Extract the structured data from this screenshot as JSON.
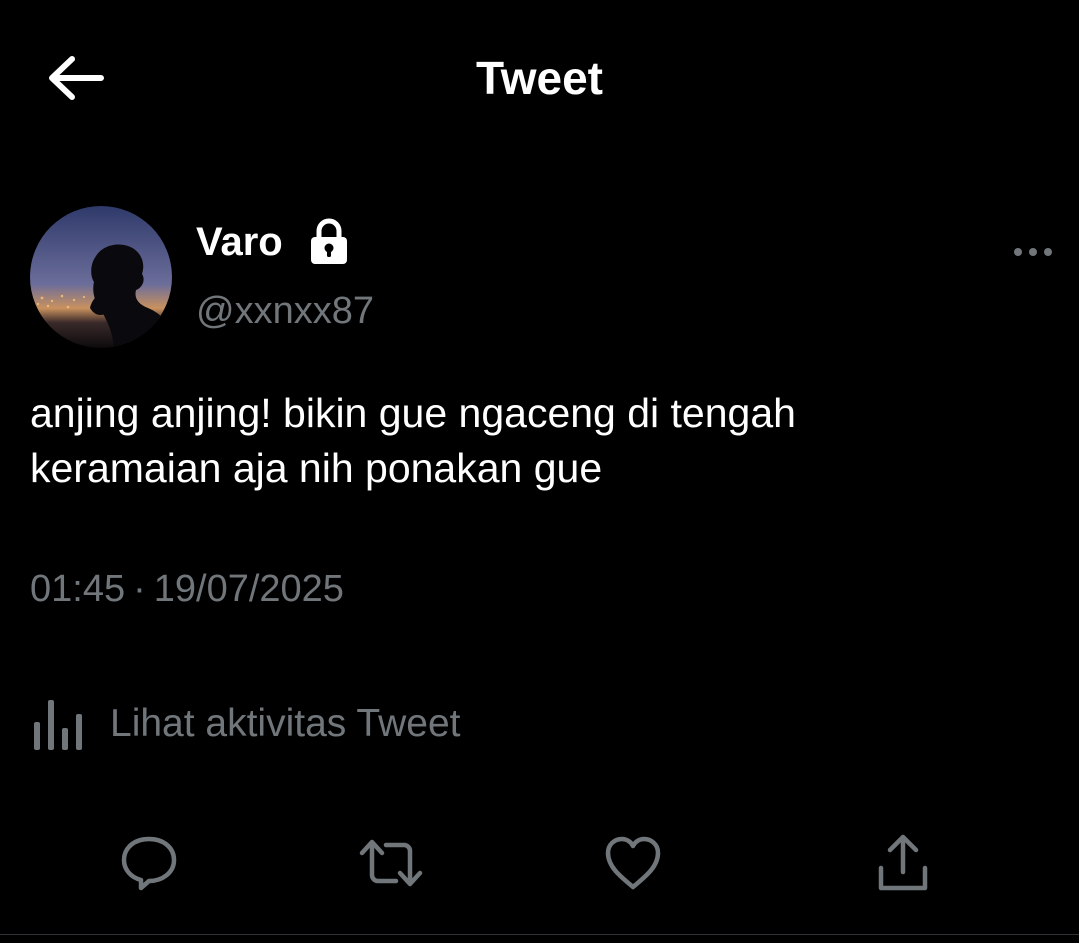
{
  "header": {
    "title": "Tweet",
    "back_icon": "arrow-left-icon"
  },
  "author": {
    "display_name": "Varo",
    "handle": "@xxnxx87",
    "protected": true,
    "lock_icon": "lock-icon",
    "avatar": "silhouette-photo-city-night"
  },
  "tweet": {
    "text_line1": "anjing anjing! bikin gue ngaceng di tengah",
    "text_line2": "keramaian aja nih ponakan gue",
    "time": "01:45",
    "separator": "·",
    "date": "19/07/2025"
  },
  "activity": {
    "label": "Lihat aktivitas Tweet",
    "icon": "bar-chart-icon"
  },
  "actions": [
    {
      "name": "reply",
      "icon": "reply-icon"
    },
    {
      "name": "retweet",
      "icon": "retweet-icon"
    },
    {
      "name": "like",
      "icon": "heart-icon"
    },
    {
      "name": "share",
      "icon": "share-icon"
    }
  ],
  "colors": {
    "background": "#000000",
    "text_primary": "#ffffff",
    "text_secondary": "#71767b",
    "icon": "#71767b"
  }
}
